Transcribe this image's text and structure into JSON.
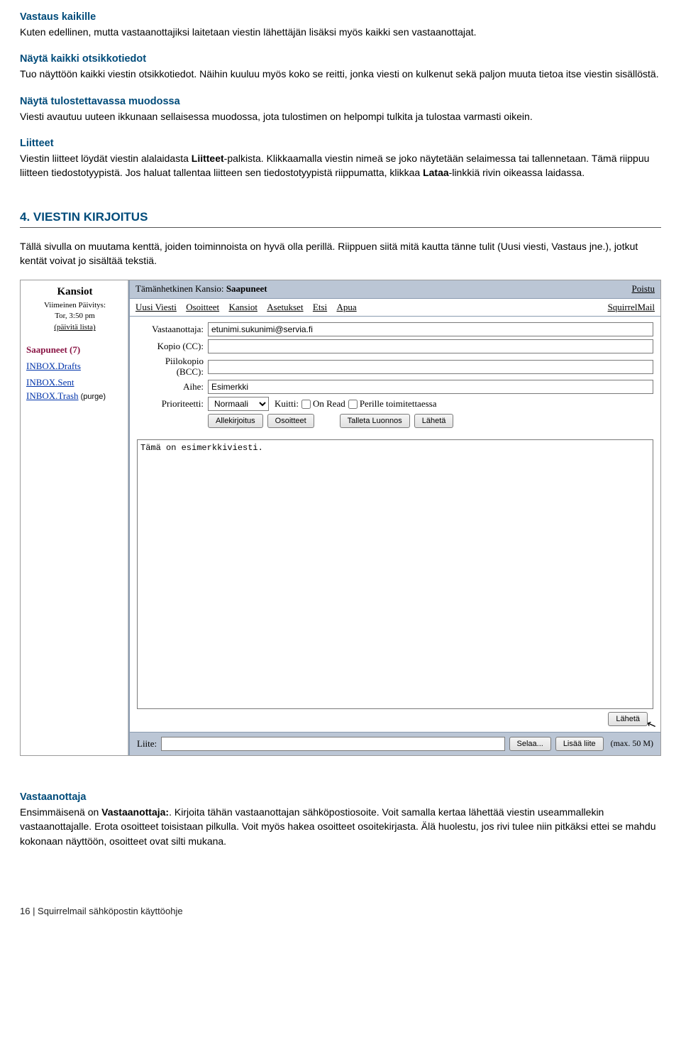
{
  "sec1": {
    "title": "Vastaus kaikille",
    "body": "Kuten edellinen, mutta vastaanottajiksi laitetaan viestin lähettäjän lisäksi myös kaikki sen vastaanottajat."
  },
  "sec2": {
    "title": "Näytä kaikki otsikkotiedot",
    "body": "Tuo näyttöön kaikki viestin otsikkotiedot. Näihin kuuluu myös koko se reitti, jonka viesti on kulkenut sekä paljon muuta tietoa itse viestin sisällöstä."
  },
  "sec3": {
    "title": "Näytä tulostettavassa muodossa",
    "body": "Viesti avautuu uuteen ikkunaan sellaisessa muodossa, jota tulostimen on helpompi tulkita ja tulostaa varmasti oikein."
  },
  "sec4": {
    "title": "Liitteet",
    "body_a": "Viestin liitteet löydät viestin alalaidasta ",
    "body_bold1": "Liitteet",
    "body_b": "-palkista. Klikkaamalla viestin nimeä se joko näytetään selaimessa tai tallennetaan. Tämä riippuu liitteen tiedostotyypistä. Jos haluat tallentaa liitteen sen tiedostotyypistä riippumatta, klikkaa ",
    "body_bold2": "Lataa",
    "body_c": "-linkkiä rivin oikeassa laidassa."
  },
  "chapter": "4. VIESTIN KIRJOITUS",
  "chapter_intro": "Tällä sivulla on muutama kenttä, joiden toiminnoista on hyvä olla perillä. Riippuen siitä mitä kautta tänne tulit (Uusi viesti, Vastaus jne.), jotkut kentät voivat jo sisältää tekstiä.",
  "shot": {
    "folders_title": "Kansiot",
    "refresh1": "Viimeinen Päivitys:",
    "refresh2": "Tor, 3:50 pm",
    "refresh3": "(päivitä lista)",
    "folders": [
      {
        "label": "Saapuneet (7)",
        "cls": "inbox"
      },
      {
        "label": "INBOX.Drafts",
        "cls": ""
      },
      {
        "label": "INBOX.Sent",
        "cls": ""
      },
      {
        "label": "INBOX.Trash",
        "cls": ""
      }
    ],
    "purge_suffix": "  (purge)",
    "current_folder_prefix": "Tämänhetkinen Kansio: ",
    "current_folder": "Saapuneet",
    "logout": "Poistu",
    "toolbar": [
      "Uusi Viesti",
      "Osoitteet",
      "Kansiot",
      "Asetukset",
      "Etsi",
      "Apua"
    ],
    "brand": "SquirrelMail",
    "labels": {
      "to": "Vastaanottaja:",
      "cc": "Kopio (CC):",
      "bcc": "Piilokopio (BCC):",
      "subject": "Aihe:",
      "priority": "Prioriteetti:",
      "receipt": "Kuitti:",
      "onread": "On Read",
      "ondelivery": "Perille toimitettaessa",
      "attach": "Liite:"
    },
    "values": {
      "to": "etunimi.sukunimi@servia.fi",
      "cc": "",
      "bcc": "",
      "subject": "Esimerkki",
      "priority": "Normaali",
      "body": "Tämä on esimerkkiviesti."
    },
    "buttons": {
      "sig": "Allekirjoitus",
      "addr": "Osoitteet",
      "draft": "Talleta Luonnos",
      "send": "Lähetä",
      "browse": "Selaa...",
      "addattach": "Lisää liite"
    },
    "maxsize": "(max. 50 M)"
  },
  "sec5": {
    "title": "Vastaanottaja",
    "body_a": "Ensimmäisenä on ",
    "body_bold1": "Vastaanottaja:",
    "body_b": ". Kirjoita tähän vastaanottajan sähköpostiosoite. Voit samalla kertaa lähettää viestin useammallekin vastaanottajalle. Erota osoitteet toisistaan pilkulla. Voit myös hakea osoitteet osoitekirjasta. Älä huolestu, jos rivi tulee niin pitkäksi ettei se mahdu kokonaan näyttöön, osoitteet ovat silti mukana."
  },
  "footer": "16   |   Squirrelmail sähköpostin käyttöohje"
}
